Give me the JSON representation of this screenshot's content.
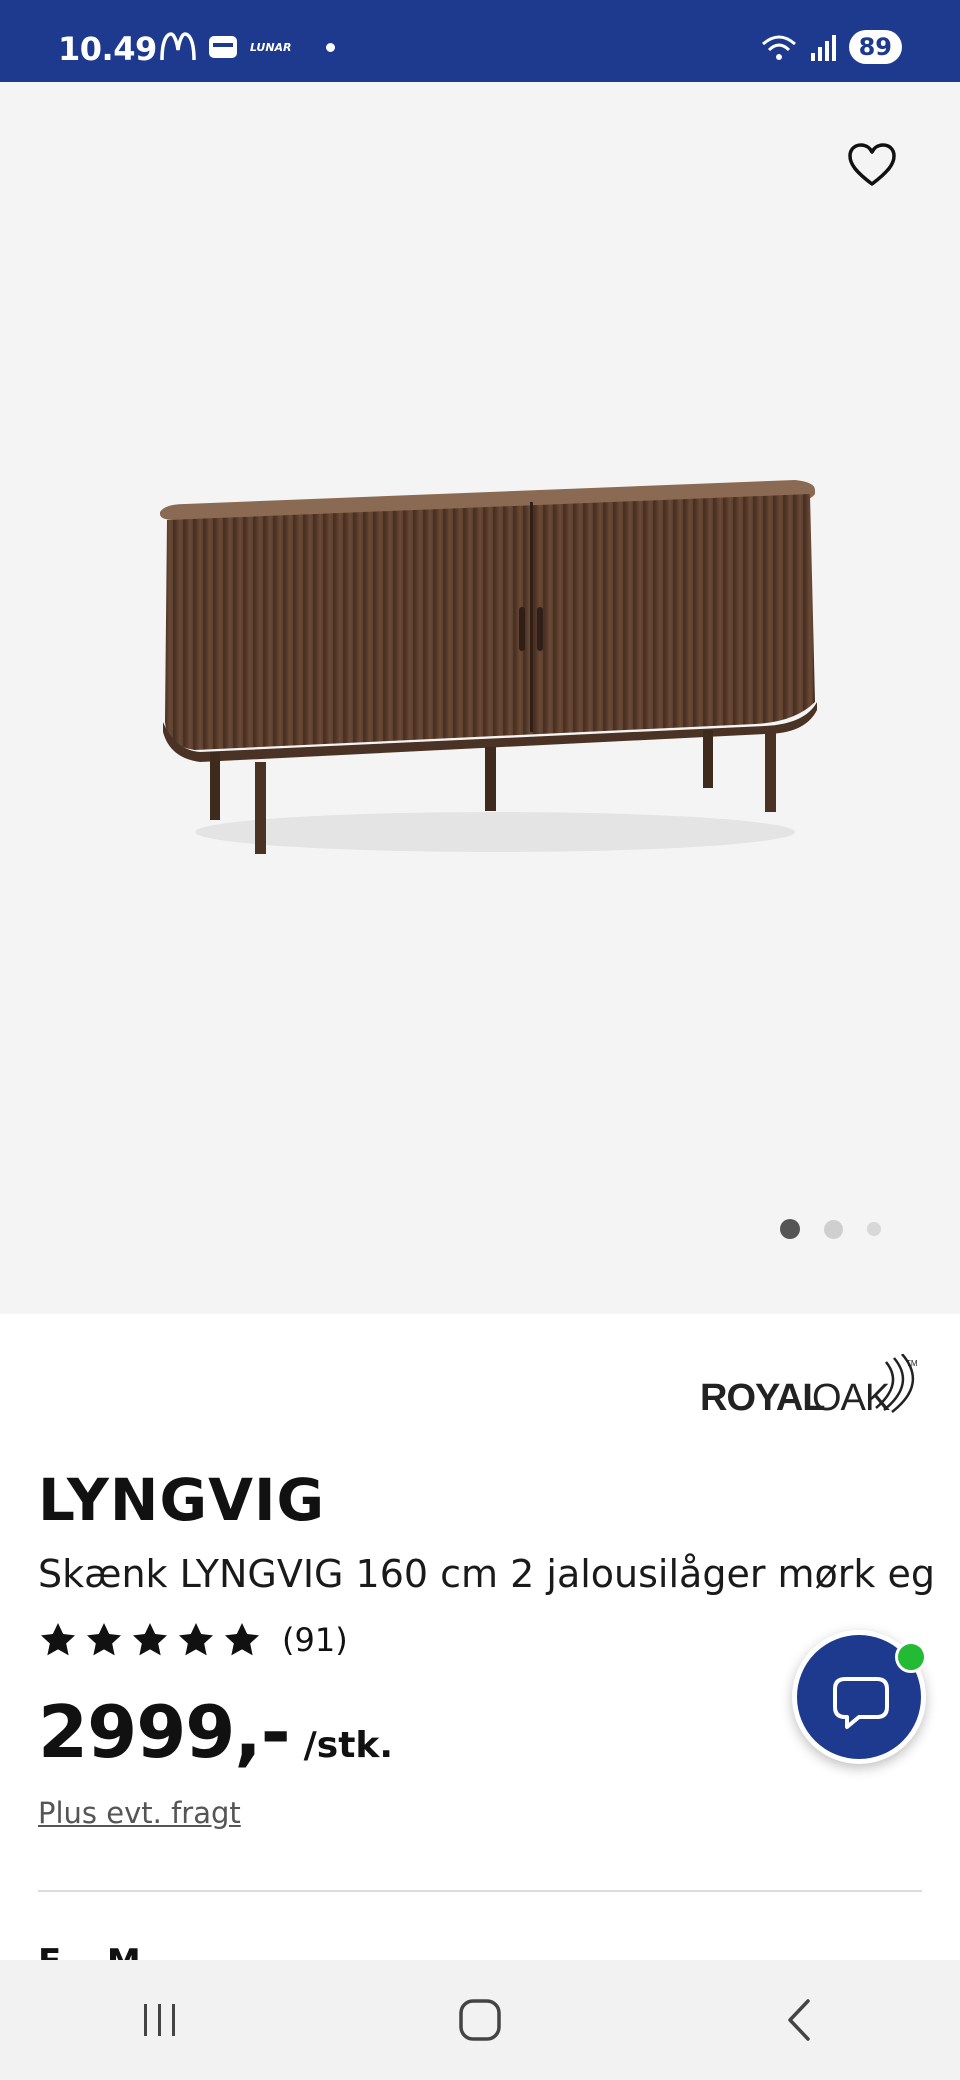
{
  "status_bar": {
    "time": "10.49",
    "left_icons": [
      "mcdonalds-icon",
      "wallet-icon",
      "lunar-icon",
      "notification-dot-icon"
    ],
    "lunar_label": "LUNAR",
    "right_icons": [
      "wifi-icon",
      "signal-icon"
    ],
    "battery": "89"
  },
  "product_gallery": {
    "image_alt": "Skænk LYNGVIG 160 cm 2 jalousilåger mørk eg",
    "favorite_icon": "heart-outline-icon",
    "page_count": 3,
    "active_page": 1
  },
  "brand": {
    "logo_text": "ROYALOAK",
    "logo_bold": "ROYAL",
    "logo_light": "OAK",
    "trademark": "TM"
  },
  "product": {
    "name": "LYNGVIG",
    "description": "Skænk LYNGVIG 160 cm 2 jalousilåger mørk eg",
    "rating_stars": 5,
    "rating_count": "(91)",
    "price": "2999,-",
    "price_unit": "/stk.",
    "shipping_note": "Plus evt. fragt",
    "next_section_partial": "F... M..."
  },
  "chat": {
    "icon": "chat-bubble-icon",
    "online_indicator_color": "#22bb33"
  },
  "colors": {
    "brand_blue": "#1d3a8e",
    "image_background": "#f4f4f4"
  },
  "nav_bar": {
    "buttons": [
      "recent-apps-icon",
      "home-icon",
      "back-icon"
    ]
  }
}
